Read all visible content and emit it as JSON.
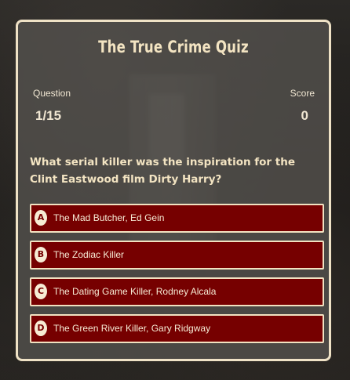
{
  "quiz": {
    "title": "The True Crime Quiz"
  },
  "stats": {
    "question_label": "Question",
    "question_value": "1/15",
    "score_label": "Score",
    "score_value": "0"
  },
  "question": {
    "text": "What serial killer was the inspiration for the Clint Eastwood film Dirty Harry?"
  },
  "answers": [
    {
      "letter": "A",
      "text": "The Mad Butcher, Ed Gein"
    },
    {
      "letter": "B",
      "text": "The Zodiac Killer"
    },
    {
      "letter": "C",
      "text": "The Dating Game Killer, Rodney Alcala"
    },
    {
      "letter": "D",
      "text": "The Green River Killer, Gary Ridgway"
    }
  ],
  "colors": {
    "card_border": "#efe2c6",
    "title_text": "#f3e4c2",
    "answer_bg": "#760000",
    "answer_border": "#f2e2c1",
    "letter_bg": "#f7ecd4"
  }
}
